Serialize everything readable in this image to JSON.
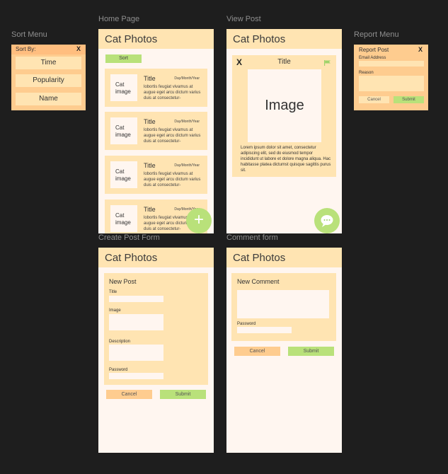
{
  "labels": {
    "sort_menu": "Sort Menu",
    "home": "Home Page",
    "view_post": "View Post",
    "report_menu": "Report Menu",
    "create_post": "Create Post Form",
    "comment_form": "Comment form"
  },
  "app_title": "Cat Photos",
  "sort_menu": {
    "heading": "Sort By:",
    "close": "X",
    "options": [
      "Time",
      "Popularity",
      "Name"
    ]
  },
  "home": {
    "sort_button": "Sort",
    "posts": [
      {
        "thumb": "Cat image",
        "title": "Title",
        "date": "Day/Month/Year",
        "body": "lobortis feugiat vivamus at augue eget arcu dictum varius duis at consectetur-"
      },
      {
        "thumb": "Cat image",
        "title": "Title",
        "date": "Day/Month/Year",
        "body": "lobortis feugiat vivamus at augue eget arcu dictum varius duis at consectetur-"
      },
      {
        "thumb": "Cat image",
        "title": "Title",
        "date": "Day/Month/Year",
        "body": "lobortis feugiat vivamus at augue eget arcu dictum varius duis at consectetur-"
      },
      {
        "thumb": "Cat image",
        "title": "Title",
        "date": "Day/Month/Year",
        "body": "lobortis feugiat vivamus at augue eget arcu dictum varius duis at consectetur-"
      }
    ],
    "fab_icon": "+"
  },
  "view_post": {
    "close": "X",
    "title": "Title",
    "image": "Image",
    "body": "Lorem ipsum dolor sit amet, consectetur adipiscing elit, sed do eiusmod tempor incididunt ut labore et dolore magna aliqua. Hac habitasse platea dictumst quisque sagittis purus sit."
  },
  "report_menu": {
    "title": "Report Post",
    "close": "X",
    "email_label": "Email Address",
    "reason_label": "Reason",
    "cancel": "Cancel",
    "submit": "Submit"
  },
  "create_post": {
    "title": "New Post",
    "title_label": "Title",
    "image_label": "Image",
    "description_label": "Description",
    "password_label": "Password",
    "cancel": "Cancel",
    "submit": "Submit"
  },
  "comment_form": {
    "title": "New Comment",
    "password_label": "Password",
    "cancel": "Cancel",
    "submit": "Submit"
  },
  "icons": {
    "flag": "flag-icon",
    "add": "plus-icon",
    "comment": "chat-bubble-icon"
  },
  "colors": {
    "background": "#1e1e1e",
    "frame": "#fff6f0",
    "header": "#ffe4b2",
    "menu": "#fecc8f",
    "accent_green": "#b9e17a"
  }
}
